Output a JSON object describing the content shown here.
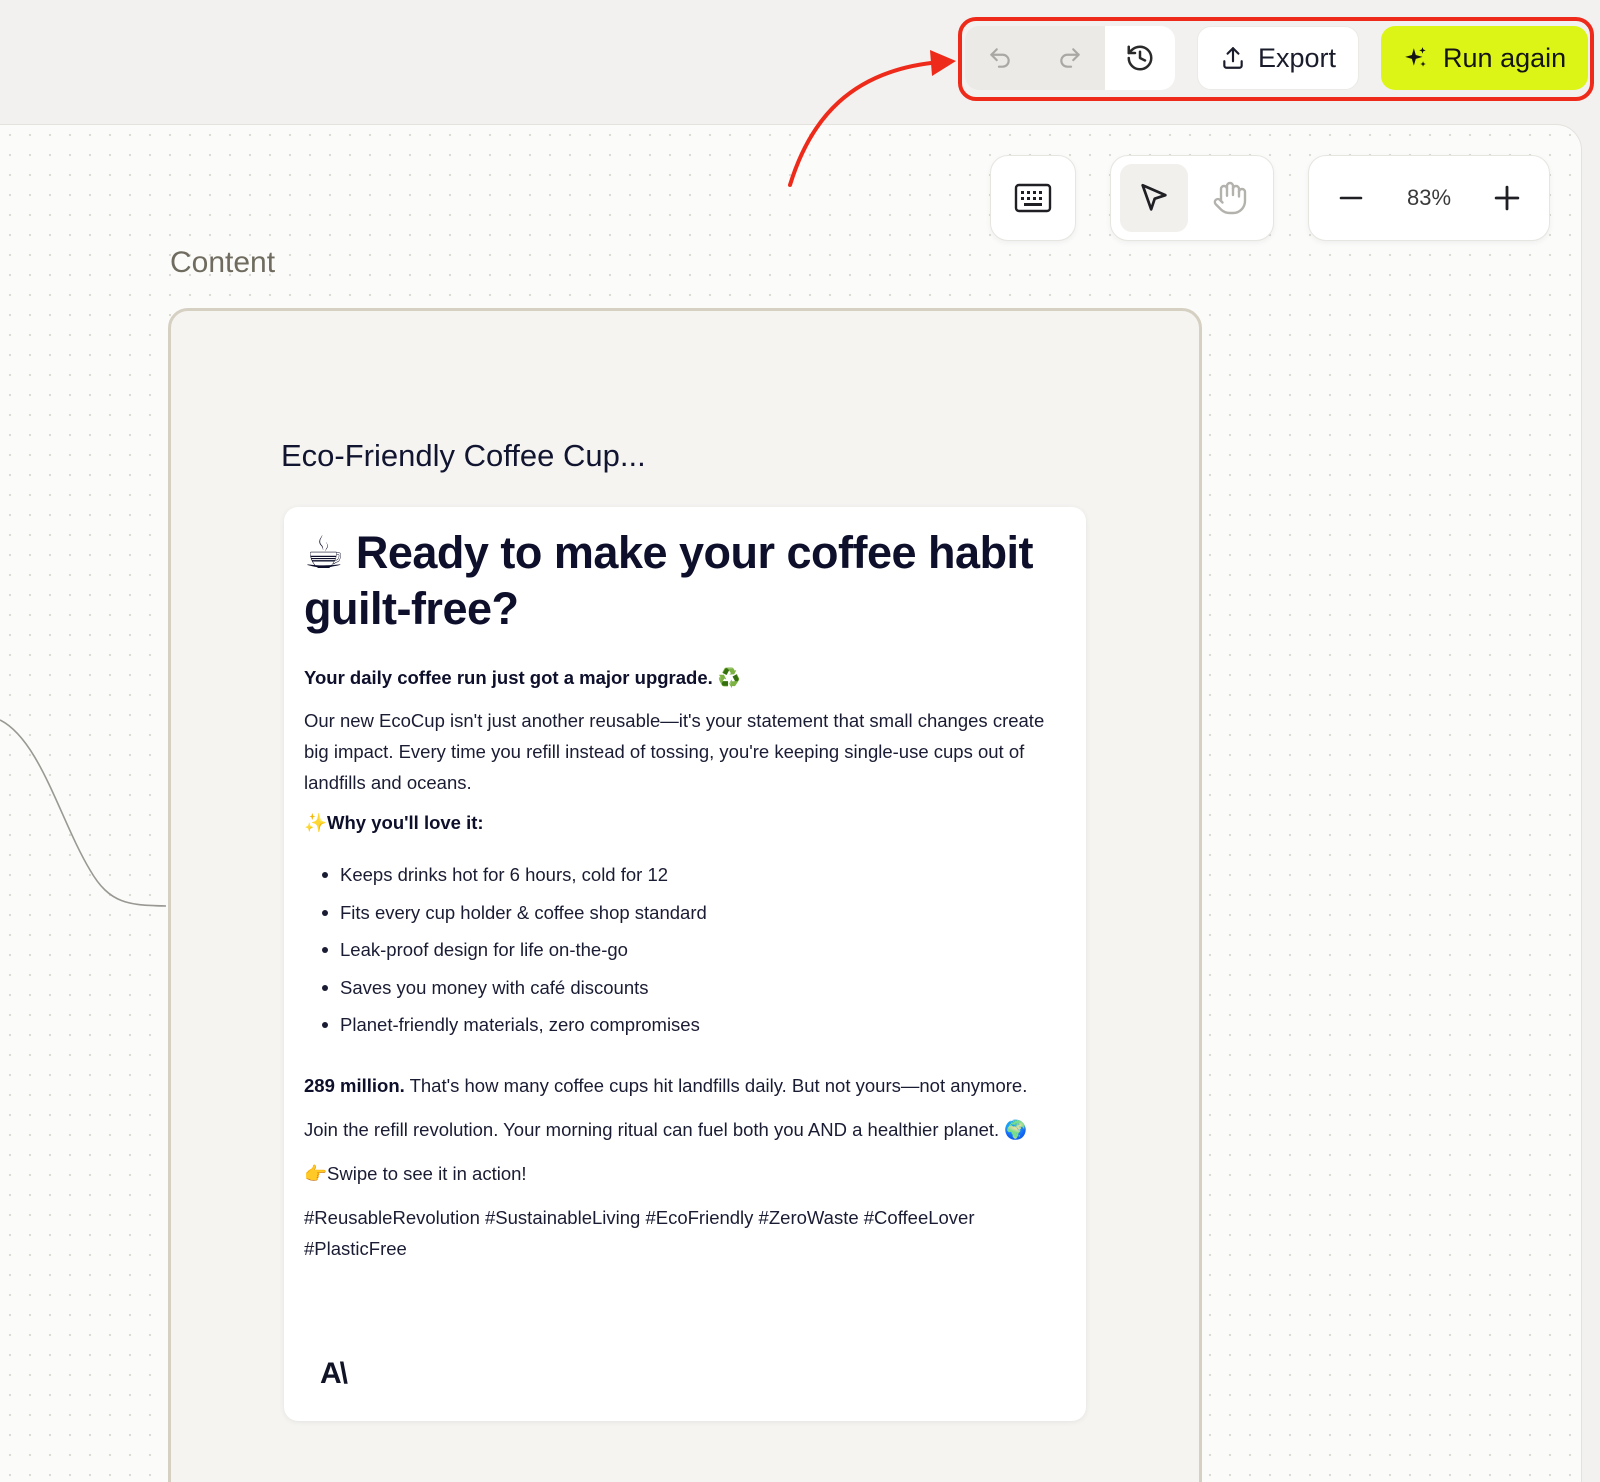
{
  "toolbar": {
    "undo_icon": "undo-icon",
    "redo_icon": "redo-icon",
    "history_icon": "history-icon",
    "export_label": "Export",
    "run_label": "Run again",
    "accent_color": "#dcf516",
    "highlight_color": "#ee2a1a"
  },
  "canvas_controls": {
    "zoom_level": "83%"
  },
  "content": {
    "section_label": "Content",
    "doc_title": "Eco-Friendly Coffee Cup...",
    "post": {
      "emoji_headline": "☕",
      "headline": "Ready to make your coffee habit guilt-free?",
      "subhead": "Your daily coffee run just got a major upgrade.",
      "subhead_emoji": "♻️",
      "body": "Our new EcoCup isn't just another reusable—it's your statement that small changes create big impact. Every time you refill instead of tossing, you're keeping single-use cups out of landfills and oceans.",
      "why_emoji": "✨",
      "why_title": "Why you'll love it:",
      "bullets": [
        "Keeps drinks hot for 6 hours, cold for 12",
        "Fits every cup holder & coffee shop standard",
        "Leak-proof design for life on-the-go",
        "Saves you money with café discounts",
        "Planet-friendly materials, zero compromises"
      ],
      "stat_bold": "289 million.",
      "stat_text": "That's how many coffee cups hit landfills daily. But not yours—not anymore.",
      "join_text": "Join the refill revolution. Your morning ritual can fuel both you AND a healthier planet.",
      "join_emoji": "🌍",
      "swipe_emoji": "👉",
      "swipe_text": "Swipe to see it in action!",
      "hashtags": "#ReusableRevolution #SustainableLiving #EcoFriendly #ZeroWaste #CoffeeLover #PlasticFree",
      "brand_logo": "A\\"
    }
  }
}
